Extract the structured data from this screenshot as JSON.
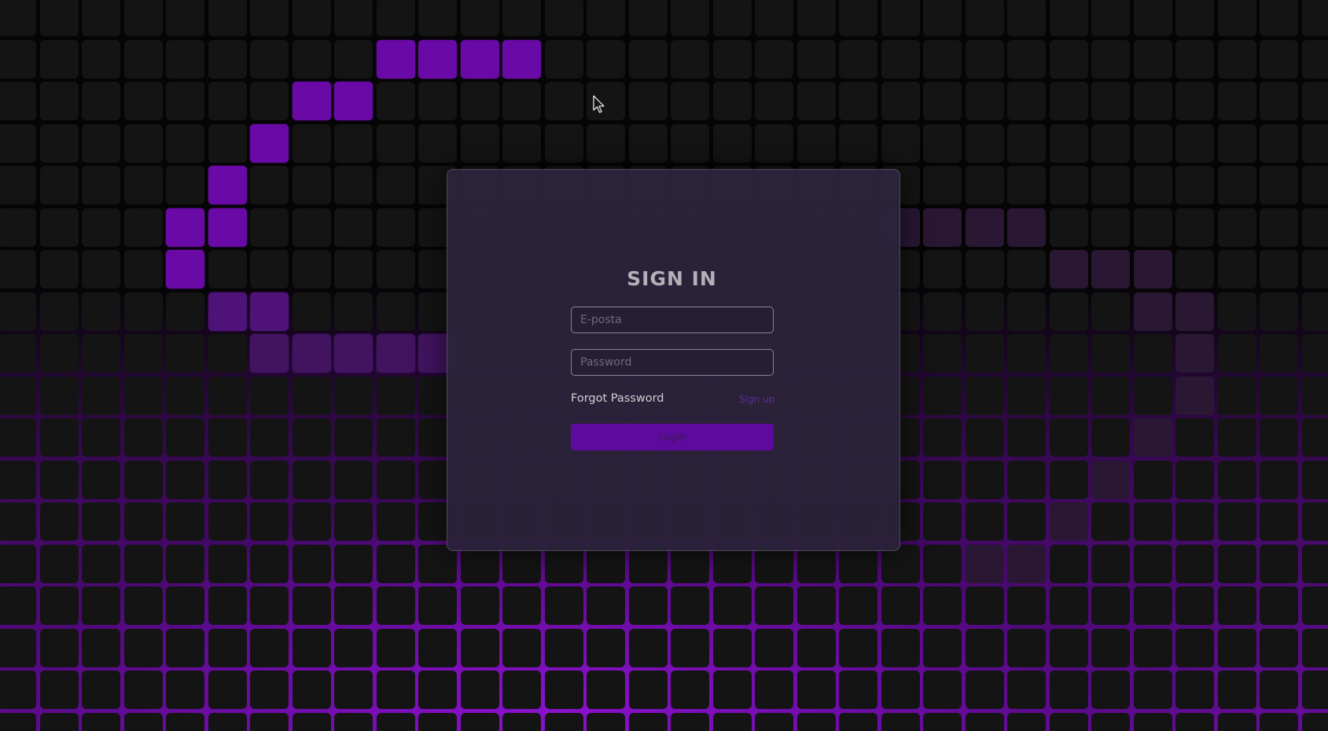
{
  "form": {
    "title": "SIGN IN",
    "email_placeholder": "E-posta",
    "password_placeholder": "Password",
    "forgot_label": "Forgot Password",
    "signup_label": "Sign up",
    "login_label": "Login"
  },
  "colors": {
    "background": "#141414",
    "accent": "#6a0aa6",
    "panel": "#2c2436",
    "button": "#5e0a9e"
  },
  "icons": {
    "cursor": "mouse-pointer-icon"
  }
}
